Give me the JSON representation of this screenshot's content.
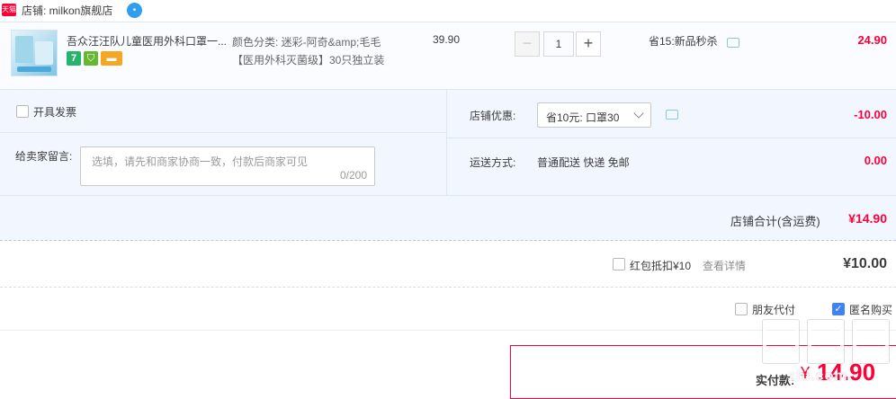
{
  "shop": {
    "logo_text": "天猫",
    "name": "店铺: milkon旗舰店"
  },
  "item": {
    "title": "吾众汪汪队儿童医用外科口罩一...",
    "badges": [
      "7",
      "shield-badge",
      "card-badge"
    ],
    "sku_color": "颜色分类: 迷彩-阿奇&amp;毛毛",
    "sku_package": "【医用外科灭菌级】30只独立装",
    "unit_price": "39.90",
    "quantity": "1",
    "promotion": "省15:新品秒杀",
    "subtotal": "24.90"
  },
  "options": {
    "invoice_label": "开具发票",
    "memo_label": "给卖家留言:",
    "memo_placeholder": "选填，请先和商家协商一致，付款后商家可见",
    "memo_count": "0/200",
    "shop_discount_label": "店铺优惠:",
    "shop_discount_selected": "省10元: 口罩30",
    "shop_discount_amount": "-10.00",
    "shipping_label": "运送方式:",
    "shipping_value": "普通配送 快递 免邮",
    "shipping_amount": "0.00"
  },
  "shop_total": {
    "label": "店铺合计(含运费)",
    "value": "¥14.90"
  },
  "red_packet": {
    "label": "红包抵扣¥10",
    "link": "查看详情",
    "amount": "¥10.00"
  },
  "payer": {
    "friend_label": "朋友代付",
    "anonymous_label": "匿名购买",
    "anonymous_checked": true
  },
  "pay": {
    "label": "实付款:",
    "currency": "¥",
    "amount": "14.90"
  },
  "watermark": {
    "glyphs": "值值值",
    "site": "zhi.com"
  },
  "colors": {
    "price_red": "#ff0036",
    "panel_blue": "#f2f7ff",
    "check_blue": "#3e82f7"
  }
}
